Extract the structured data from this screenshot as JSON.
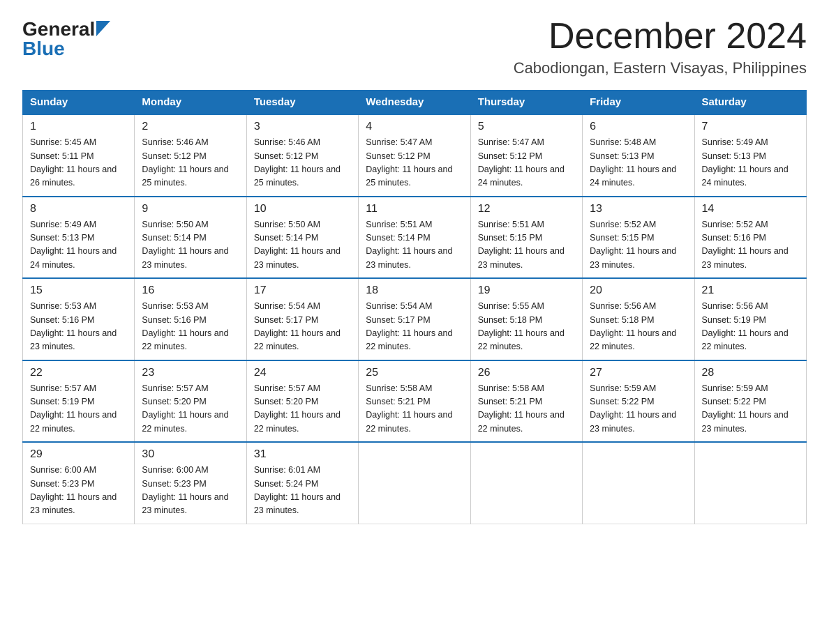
{
  "logo": {
    "general": "General",
    "blue": "Blue"
  },
  "title": {
    "month": "December 2024",
    "location": "Cabodiongan, Eastern Visayas, Philippines"
  },
  "weekdays": [
    "Sunday",
    "Monday",
    "Tuesday",
    "Wednesday",
    "Thursday",
    "Friday",
    "Saturday"
  ],
  "weeks": [
    [
      {
        "day": "1",
        "sunrise": "5:45 AM",
        "sunset": "5:11 PM",
        "daylight": "11 hours and 26 minutes."
      },
      {
        "day": "2",
        "sunrise": "5:46 AM",
        "sunset": "5:12 PM",
        "daylight": "11 hours and 25 minutes."
      },
      {
        "day": "3",
        "sunrise": "5:46 AM",
        "sunset": "5:12 PM",
        "daylight": "11 hours and 25 minutes."
      },
      {
        "day": "4",
        "sunrise": "5:47 AM",
        "sunset": "5:12 PM",
        "daylight": "11 hours and 25 minutes."
      },
      {
        "day": "5",
        "sunrise": "5:47 AM",
        "sunset": "5:12 PM",
        "daylight": "11 hours and 24 minutes."
      },
      {
        "day": "6",
        "sunrise": "5:48 AM",
        "sunset": "5:13 PM",
        "daylight": "11 hours and 24 minutes."
      },
      {
        "day": "7",
        "sunrise": "5:49 AM",
        "sunset": "5:13 PM",
        "daylight": "11 hours and 24 minutes."
      }
    ],
    [
      {
        "day": "8",
        "sunrise": "5:49 AM",
        "sunset": "5:13 PM",
        "daylight": "11 hours and 24 minutes."
      },
      {
        "day": "9",
        "sunrise": "5:50 AM",
        "sunset": "5:14 PM",
        "daylight": "11 hours and 23 minutes."
      },
      {
        "day": "10",
        "sunrise": "5:50 AM",
        "sunset": "5:14 PM",
        "daylight": "11 hours and 23 minutes."
      },
      {
        "day": "11",
        "sunrise": "5:51 AM",
        "sunset": "5:14 PM",
        "daylight": "11 hours and 23 minutes."
      },
      {
        "day": "12",
        "sunrise": "5:51 AM",
        "sunset": "5:15 PM",
        "daylight": "11 hours and 23 minutes."
      },
      {
        "day": "13",
        "sunrise": "5:52 AM",
        "sunset": "5:15 PM",
        "daylight": "11 hours and 23 minutes."
      },
      {
        "day": "14",
        "sunrise": "5:52 AM",
        "sunset": "5:16 PM",
        "daylight": "11 hours and 23 minutes."
      }
    ],
    [
      {
        "day": "15",
        "sunrise": "5:53 AM",
        "sunset": "5:16 PM",
        "daylight": "11 hours and 23 minutes."
      },
      {
        "day": "16",
        "sunrise": "5:53 AM",
        "sunset": "5:16 PM",
        "daylight": "11 hours and 22 minutes."
      },
      {
        "day": "17",
        "sunrise": "5:54 AM",
        "sunset": "5:17 PM",
        "daylight": "11 hours and 22 minutes."
      },
      {
        "day": "18",
        "sunrise": "5:54 AM",
        "sunset": "5:17 PM",
        "daylight": "11 hours and 22 minutes."
      },
      {
        "day": "19",
        "sunrise": "5:55 AM",
        "sunset": "5:18 PM",
        "daylight": "11 hours and 22 minutes."
      },
      {
        "day": "20",
        "sunrise": "5:56 AM",
        "sunset": "5:18 PM",
        "daylight": "11 hours and 22 minutes."
      },
      {
        "day": "21",
        "sunrise": "5:56 AM",
        "sunset": "5:19 PM",
        "daylight": "11 hours and 22 minutes."
      }
    ],
    [
      {
        "day": "22",
        "sunrise": "5:57 AM",
        "sunset": "5:19 PM",
        "daylight": "11 hours and 22 minutes."
      },
      {
        "day": "23",
        "sunrise": "5:57 AM",
        "sunset": "5:20 PM",
        "daylight": "11 hours and 22 minutes."
      },
      {
        "day": "24",
        "sunrise": "5:57 AM",
        "sunset": "5:20 PM",
        "daylight": "11 hours and 22 minutes."
      },
      {
        "day": "25",
        "sunrise": "5:58 AM",
        "sunset": "5:21 PM",
        "daylight": "11 hours and 22 minutes."
      },
      {
        "day": "26",
        "sunrise": "5:58 AM",
        "sunset": "5:21 PM",
        "daylight": "11 hours and 22 minutes."
      },
      {
        "day": "27",
        "sunrise": "5:59 AM",
        "sunset": "5:22 PM",
        "daylight": "11 hours and 23 minutes."
      },
      {
        "day": "28",
        "sunrise": "5:59 AM",
        "sunset": "5:22 PM",
        "daylight": "11 hours and 23 minutes."
      }
    ],
    [
      {
        "day": "29",
        "sunrise": "6:00 AM",
        "sunset": "5:23 PM",
        "daylight": "11 hours and 23 minutes."
      },
      {
        "day": "30",
        "sunrise": "6:00 AM",
        "sunset": "5:23 PM",
        "daylight": "11 hours and 23 minutes."
      },
      {
        "day": "31",
        "sunrise": "6:01 AM",
        "sunset": "5:24 PM",
        "daylight": "11 hours and 23 minutes."
      },
      null,
      null,
      null,
      null
    ]
  ]
}
